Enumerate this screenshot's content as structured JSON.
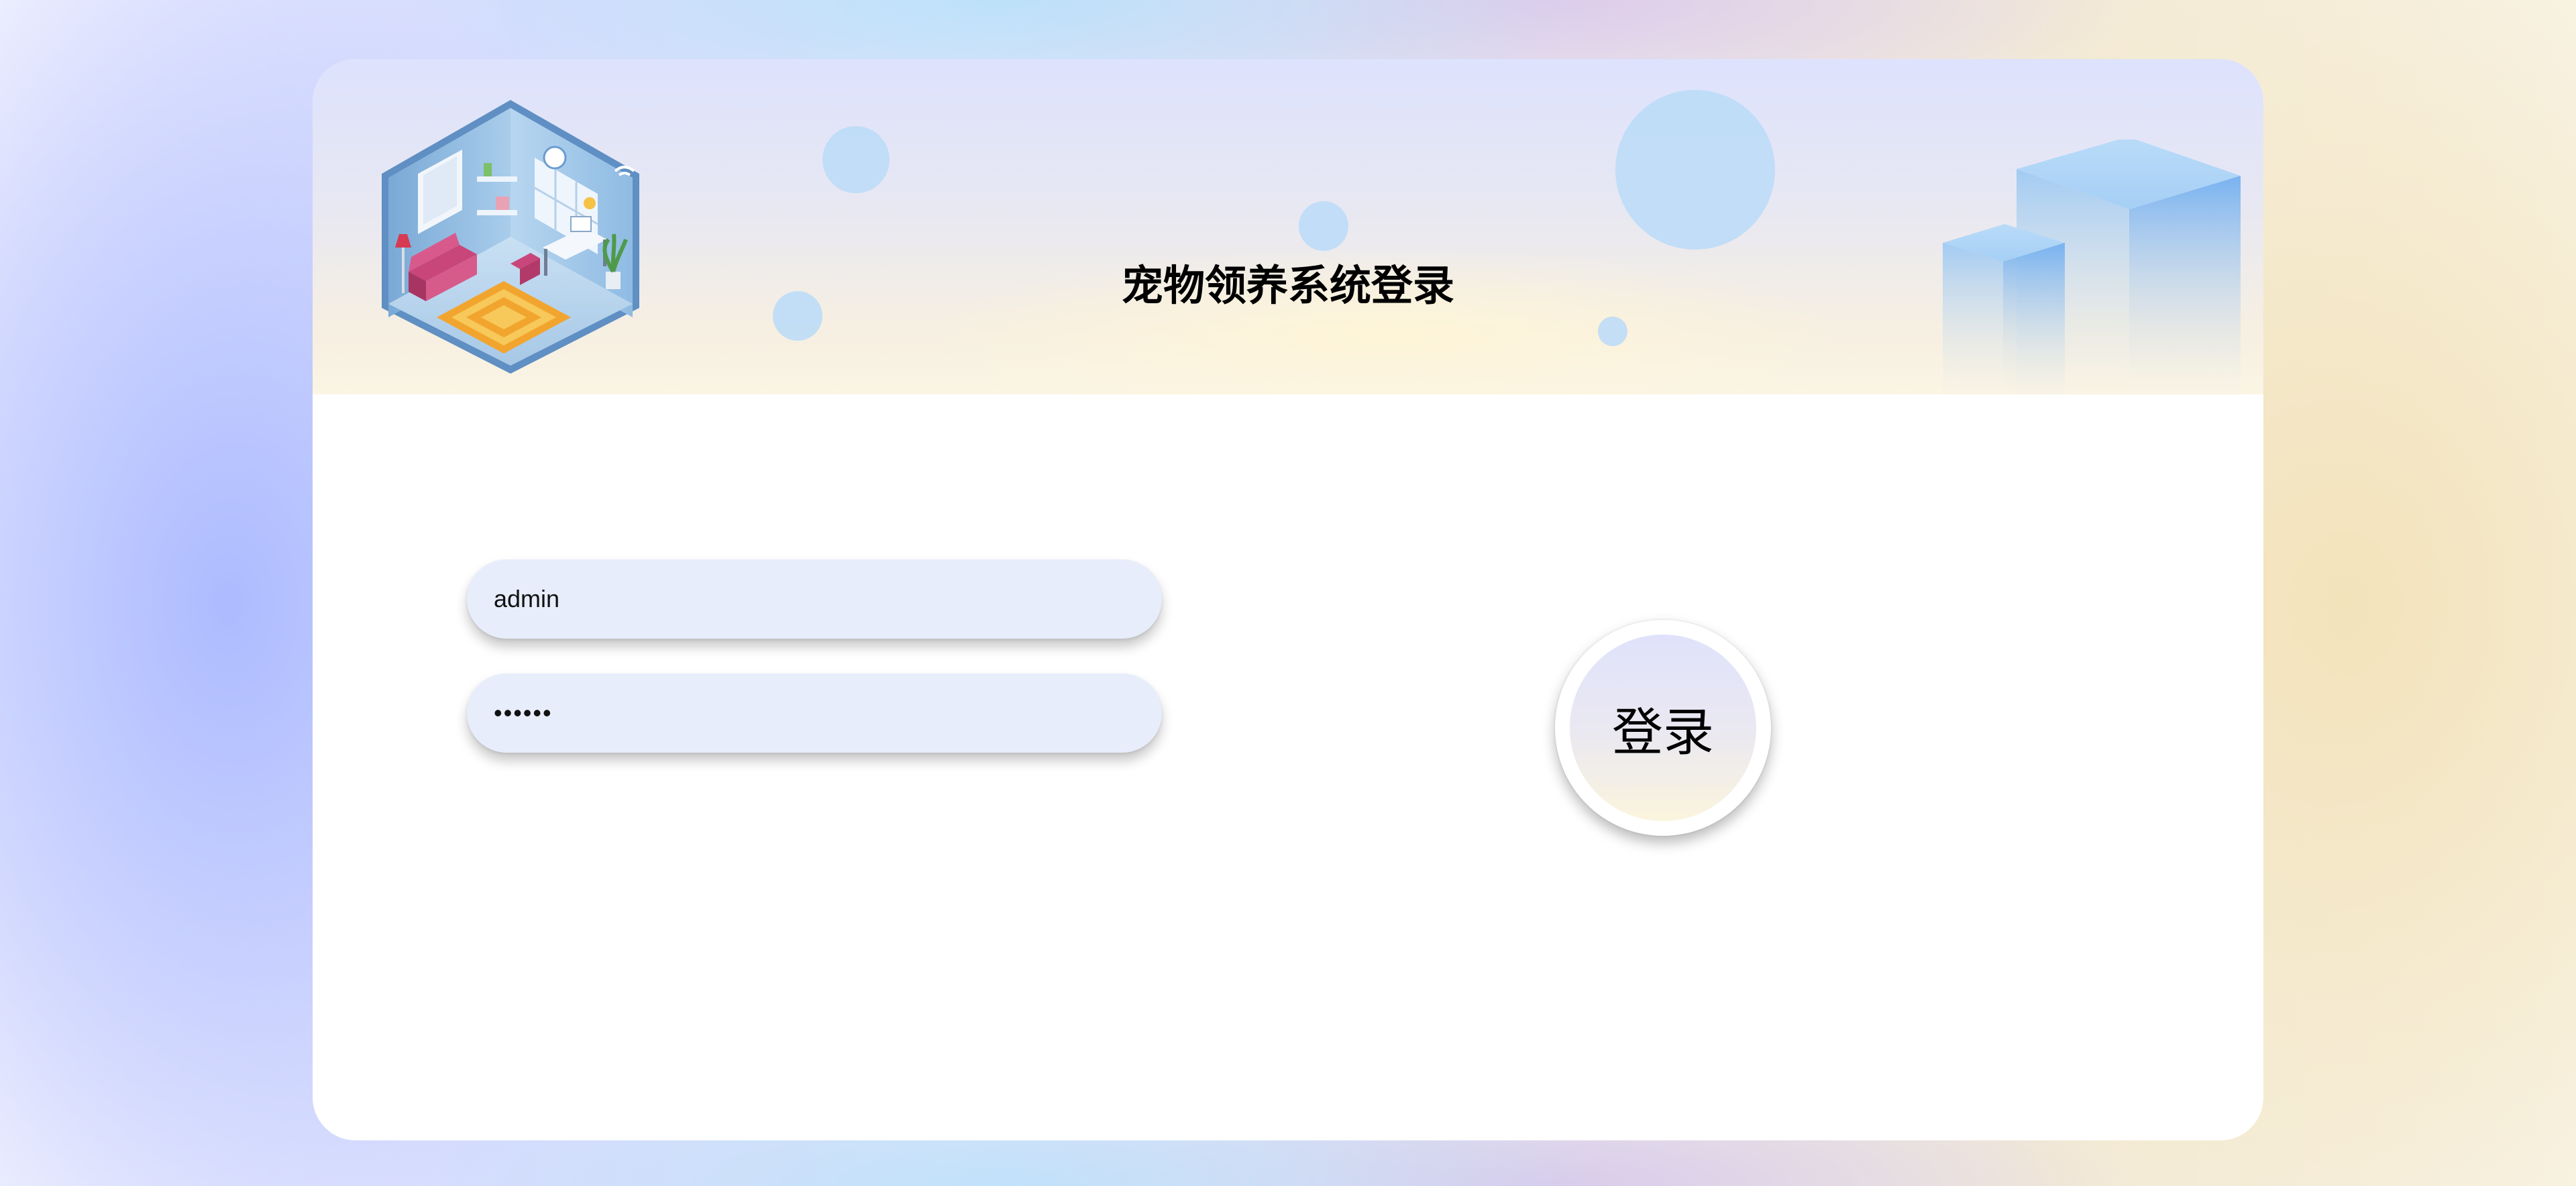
{
  "header": {
    "title": "宠物领养系统登录"
  },
  "form": {
    "username_value": "admin",
    "password_value": "123456",
    "password_placeholder": ""
  },
  "login_button": {
    "label": "登录"
  },
  "colors": {
    "field_background": "#e7edfb",
    "bubble": "#bcdcf7",
    "cube": "#7fb6f2"
  },
  "icons": {
    "header_illustration": "isometric-room-illustration",
    "header_decoration": "blue-cubes-decoration"
  }
}
